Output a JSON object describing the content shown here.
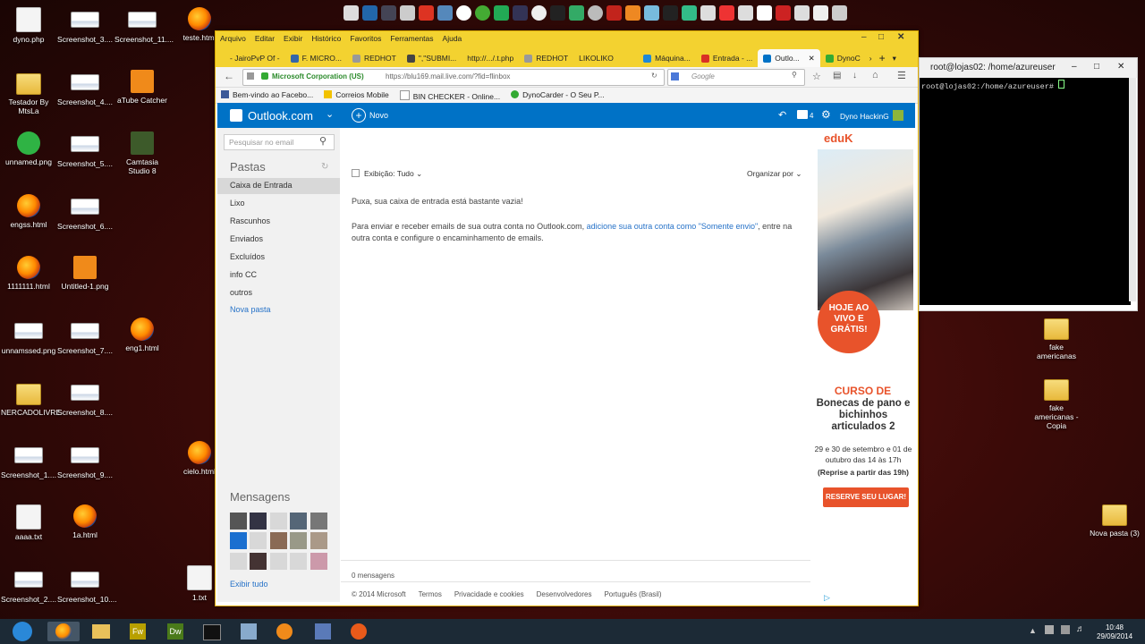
{
  "desktop": {
    "icons_left": [
      {
        "label": "dyno.php",
        "kind": "file"
      },
      {
        "label": "Testador By MtsLa",
        "kind": "folder"
      },
      {
        "label": "unnamed.png",
        "kind": "green"
      },
      {
        "label": "engss.html",
        "kind": "ff"
      },
      {
        "label": "1111111.html",
        "kind": "ff"
      },
      {
        "label": "unnamssed.png",
        "kind": "shot"
      },
      {
        "label": "NERCADOLIVRE",
        "kind": "folder"
      },
      {
        "label": "Screenshot_1....",
        "kind": "shot"
      },
      {
        "label": "aaaa.txt",
        "kind": "file"
      },
      {
        "label": "Screenshot_2....",
        "kind": "shot"
      }
    ],
    "icons_col2": [
      {
        "label": "Screenshot_3....",
        "kind": "shot"
      },
      {
        "label": "Screenshot_4....",
        "kind": "shot"
      },
      {
        "label": "Screenshot_5....",
        "kind": "shot"
      },
      {
        "label": "Screenshot_6....",
        "kind": "shot"
      },
      {
        "label": "Untitled-1.png",
        "kind": "orange"
      },
      {
        "label": "Screenshot_7....",
        "kind": "shot"
      },
      {
        "label": "Screenshot_8....",
        "kind": "shot"
      },
      {
        "label": "Screenshot_9....",
        "kind": "shot"
      },
      {
        "label": "1a.html",
        "kind": "ff"
      },
      {
        "label": "Screenshot_10....",
        "kind": "shot"
      }
    ],
    "icons_col3": [
      {
        "label": "Screenshot_11....",
        "kind": "shot"
      },
      {
        "label": "aTube Catcher",
        "kind": "orange"
      },
      {
        "label": "Camtasia Studio 8",
        "kind": "cam"
      }
    ],
    "icons_col3b": [
      {
        "label": "eng1.html",
        "kind": "ff"
      }
    ],
    "icons_col4": [
      {
        "label": "teste.html",
        "kind": "ff"
      },
      {
        "label": "cielo.html",
        "kind": "ff"
      },
      {
        "label": "1.txt",
        "kind": "file"
      }
    ],
    "icons_right": [
      {
        "label": "fake americanas",
        "kind": "folder"
      },
      {
        "label": "fake americanas - Copia",
        "kind": "folder"
      },
      {
        "label": "Nova pasta (3)",
        "kind": "folder"
      }
    ]
  },
  "browser": {
    "menu": [
      "Arquivo",
      "Editar",
      "Exibir",
      "Histórico",
      "Favoritos",
      "Ferramentas",
      "Ajuda"
    ],
    "tabs": [
      {
        "label": "- JairoPvP Of -",
        "active": false
      },
      {
        "label": "F. MICRO...",
        "active": false
      },
      {
        "label": "REDHOT",
        "active": false
      },
      {
        "label": "\",\"SUBMI...",
        "active": false
      },
      {
        "label": "http://.../.t.php",
        "active": false
      },
      {
        "label": "REDHOT",
        "active": false
      },
      {
        "label": "LIKOLIKO",
        "active": false
      },
      {
        "label": "Máquina...",
        "active": false
      },
      {
        "label": "Entrada - ...",
        "active": false
      },
      {
        "label": "Outlo...",
        "active": true
      },
      {
        "label": "DynoC",
        "active": false
      }
    ],
    "identity": "Microsoft Corporation (US)",
    "url": "https://blu169.mail.live.com/?fid=flinbox",
    "search_placeholder": "Google",
    "bookmarks": [
      "Bem-vindo ao Facebo...",
      "Correios Mobile",
      "BIN CHECKER - Online...",
      "DynoCarder - O Seu P..."
    ]
  },
  "outlook": {
    "brand": "Outlook.com",
    "new_label": "Novo",
    "messages_badge": "4",
    "user": "Dyno HackinG",
    "search_placeholder": "Pesquisar no email",
    "folders_heading": "Pastas",
    "folders": [
      "Caixa de Entrada",
      "Lixo",
      "Rascunhos",
      "Enviados",
      "Excluídos",
      "info CC",
      "outros"
    ],
    "new_folder": "Nova pasta",
    "view_filter": "Exibição: Tudo",
    "sort": "Organizar por",
    "empty_msg": "Puxa, sua caixa de entrada está bastante vazia!",
    "info_pre": "Para enviar e receber emails de sua outra conta no Outlook.com,",
    "info_link": "adicione sua outra conta como \"Somente envio\"",
    "info_post": ", entre na outra conta e configure o encaminhamento de emails.",
    "count": "0 mensagens",
    "footer": [
      "© 2014 Microsoft",
      "Termos",
      "Privacidade e cookies",
      "Desenvolvedores",
      "Português (Brasil)"
    ],
    "messenger_heading": "Mensagens",
    "see_all": "Exibir tudo"
  },
  "ad": {
    "logo": "eduK",
    "badge": "HOJE AO VIVO E GRÁTIS!",
    "course_title": "CURSO DE",
    "course_name": "Bonecas de pano e bichinhos articulados 2",
    "dates": "29 e 30 de setembro e 01 de outubro das 14 às 17h",
    "rerun": "(Reprise a partir das 19h)",
    "cta": "RESERVE SEU LUGAR!"
  },
  "terminal": {
    "title": "root@lojas02: /home/azureuser",
    "prompt": "root@lojas02:/home/azureuser# "
  },
  "taskbar": {
    "time": "10:48",
    "date": "29/09/2014"
  }
}
